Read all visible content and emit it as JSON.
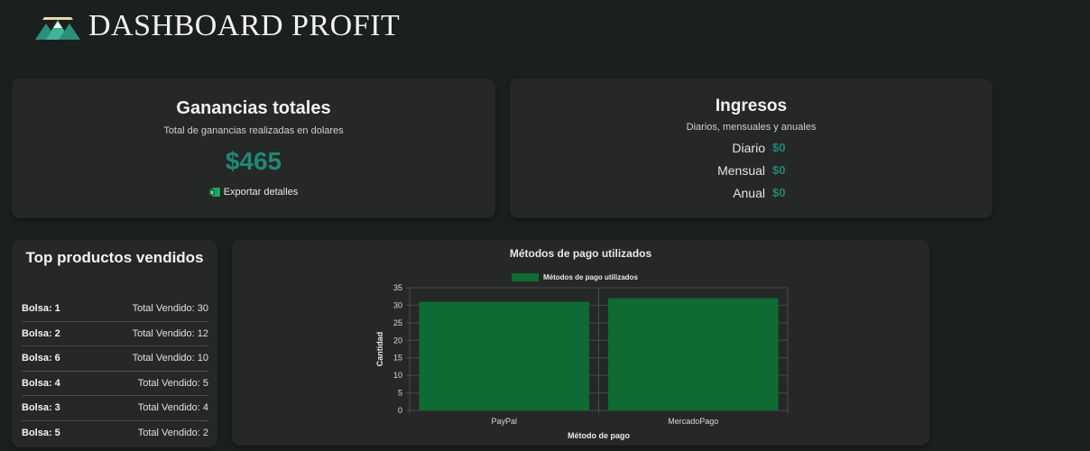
{
  "header": {
    "title": "DASHBOARD PROFIT",
    "logo_icon": "mountain-logo-icon"
  },
  "ganancias": {
    "title": "Ganancias totales",
    "subtitle": "Total de ganancias realizadas en dolares",
    "amount": "$465",
    "export_label": "Exportar detalles",
    "accent_color": "#1d8a73"
  },
  "ingresos": {
    "title": "Ingresos",
    "subtitle": "Diarios, mensuales y anuales",
    "rows": [
      {
        "label": "Diario",
        "value": "$0"
      },
      {
        "label": "Mensual",
        "value": "$0"
      },
      {
        "label": "Anual",
        "value": "$0"
      }
    ]
  },
  "top_productos": {
    "title": "Top productos vendidos",
    "items": [
      {
        "name": "Bolsa: 1",
        "sold": "Total Vendido: 30"
      },
      {
        "name": "Bolsa: 2",
        "sold": "Total Vendido: 12"
      },
      {
        "name": "Bolsa: 6",
        "sold": "Total Vendido: 10"
      },
      {
        "name": "Bolsa: 4",
        "sold": "Total Vendido: 5"
      },
      {
        "name": "Bolsa: 3",
        "sold": "Total Vendido: 4"
      },
      {
        "name": "Bolsa: 5",
        "sold": "Total Vendido: 2"
      }
    ]
  },
  "chart_data": {
    "type": "bar",
    "title": "Métodos de pago utilizados",
    "categories": [
      "PayPal",
      "MercadoPago"
    ],
    "series": [
      {
        "name": "Métodos de pago utilizados",
        "values": [
          31,
          32
        ],
        "color": "#0e6b34"
      }
    ],
    "xlabel": "Método de pago",
    "ylabel": "Cantidad",
    "ylim": [
      0,
      35
    ],
    "yticks": [
      0,
      5,
      10,
      15,
      20,
      25,
      30,
      35
    ],
    "grid": true,
    "legend": "top-center"
  }
}
